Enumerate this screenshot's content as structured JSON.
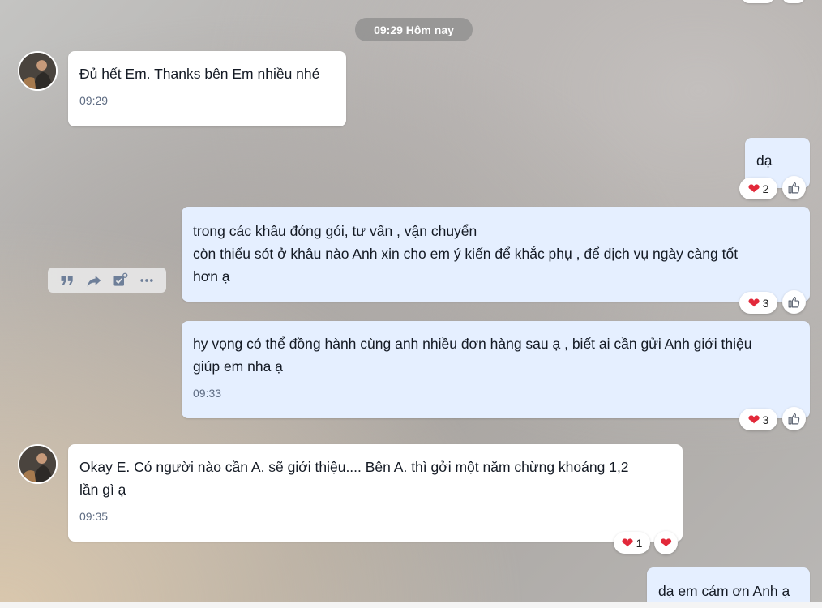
{
  "date_separator": "09:29 Hôm nay",
  "messages": [
    {
      "lines": [
        "Đủ hết Em. Thanks bên Em nhiều nhé"
      ],
      "time": "09:29"
    },
    {
      "lines": [
        "dạ"
      ],
      "reactions": {
        "emoji": "heart",
        "count": "2"
      }
    },
    {
      "lines": [
        "trong các khâu đóng gói, tư vấn  , vận chuyển",
        "còn thiếu sót ở khâu nào Anh xin cho em ý kiến để khắc phụ , để dịch vụ ngày càng tốt",
        "hơn ạ"
      ],
      "reactions": {
        "emoji": "heart",
        "count": "3"
      }
    },
    {
      "lines": [
        "hy vọng có thể đồng hành cùng anh nhiều đơn hàng sau ạ , biết ai cần gửi Anh giới thiệu",
        "giúp em nha ạ"
      ],
      "time": "09:33",
      "reactions": {
        "emoji": "heart",
        "count": "3"
      }
    },
    {
      "lines": [
        "Okay E.  Có người nào cần A. sẽ giới thiệu.... Bên A. thì gởi một năm chừng khoáng 1,2",
        "lần gì ạ"
      ],
      "time": "09:35",
      "reactions": {
        "emoji": "heart",
        "count": "1"
      }
    },
    {
      "lines": [
        "dạ em cám ơn Anh ạ"
      ]
    }
  ],
  "hover_toolbar": [
    "quote-icon",
    "forward-icon",
    "select-icon",
    "more-icon"
  ],
  "colors": {
    "incoming_bubble": "#ffffff",
    "outgoing_bubble": "#e5efff",
    "heart": "#e2293a",
    "time_text": "#5d6b82"
  }
}
